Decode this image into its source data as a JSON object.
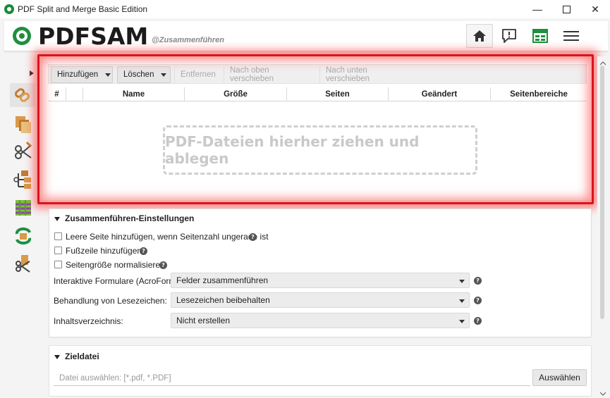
{
  "window": {
    "title": "PDF Split and Merge Basic Edition",
    "minimize": "—",
    "maximize": "☐",
    "close": "✕"
  },
  "header": {
    "logo_pdf": "PDF",
    "logo_sam": "SAM",
    "subtitle": "@Zusammenführen",
    "buttons": [
      "home-icon",
      "feedback-icon",
      "dashboard-icon",
      "menu-icon"
    ]
  },
  "sidebar": {
    "items": [
      "merge-tool-icon",
      "split-tool-icon",
      "split-scissors-icon",
      "split-by-bookmarks-icon",
      "alternate-mix-icon",
      "rotate-icon",
      "extract-pages-icon"
    ]
  },
  "toolbar": {
    "add_label": "Hinzufügen",
    "remove_label": "Löschen",
    "clear_label": "Entfernen",
    "move_up_label": "Nach oben verschieben",
    "move_down_label": "Nach unten verschieben"
  },
  "table": {
    "columns": [
      "#",
      "",
      "Name",
      "Größe",
      "Seiten",
      "Geändert",
      "Seitenbereiche"
    ]
  },
  "dropzone": {
    "text": "PDF-Dateien hierher ziehen und ablegen"
  },
  "settings": {
    "title": "Zusammenführen-Einstellungen",
    "checkboxes": [
      {
        "label": "Leere Seite hinzufügen, wenn Seitenzahl ungerade ist",
        "checked": false
      },
      {
        "label": "Fußzeile hinzufügen",
        "checked": false
      },
      {
        "label": "Seitengröße normalisieren",
        "checked": false
      }
    ],
    "fields": [
      {
        "label": "Interaktive Formulare (AcroForms)",
        "value": "Felder zusammenführen"
      },
      {
        "label": "Behandlung von Lesezeichen:",
        "value": "Lesezeichen beibehalten"
      },
      {
        "label": "Inhaltsverzeichnis:",
        "value": "Nicht erstellen"
      }
    ],
    "help_glyph": "?"
  },
  "destination": {
    "title": "Zieldatei",
    "placeholder": "Datei auswählen: [*.pdf, *.PDF]",
    "browse_label": "Auswählen"
  },
  "colors": {
    "brand_green": "#1f8f3f",
    "highlight_red": "#d8151b"
  }
}
